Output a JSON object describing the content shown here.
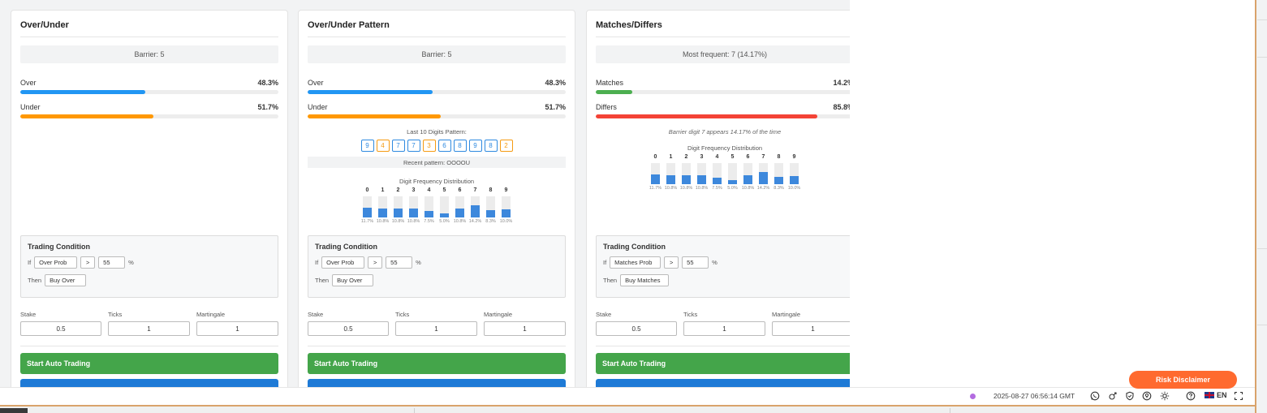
{
  "cards": [
    {
      "title": "Over/Under",
      "info": "Barrier: 5",
      "rows": [
        {
          "label": "Over",
          "value": "48.3%",
          "fraction": 0.483,
          "color": "#2196f3"
        },
        {
          "label": "Under",
          "value": "51.7%",
          "fraction": 0.517,
          "color": "#ff9800"
        }
      ],
      "condition": {
        "title": "Trading Condition",
        "if_label": "If",
        "metric": "Over Prob",
        "operator": ">",
        "threshold": "55",
        "unit": "%",
        "then_label": "Then",
        "action": "Buy Over"
      },
      "fields": [
        {
          "label": "Stake",
          "value": "0.5"
        },
        {
          "label": "Ticks",
          "value": "1"
        },
        {
          "label": "Martingale",
          "value": "1"
        }
      ],
      "start_label": "Start Auto Trading"
    },
    {
      "title": "Over/Under Pattern",
      "info": "Barrier: 5",
      "rows": [
        {
          "label": "Over",
          "value": "48.3%",
          "fraction": 0.483,
          "color": "#2196f3"
        },
        {
          "label": "Under",
          "value": "51.7%",
          "fraction": 0.517,
          "color": "#ff9800"
        }
      ],
      "pattern_title": "Last 10 Digits Pattern:",
      "pattern": [
        {
          "digit": "9",
          "type": "over"
        },
        {
          "digit": "4",
          "type": "under"
        },
        {
          "digit": "7",
          "type": "over"
        },
        {
          "digit": "7",
          "type": "over"
        },
        {
          "digit": "3",
          "type": "under"
        },
        {
          "digit": "6",
          "type": "over"
        },
        {
          "digit": "8",
          "type": "over"
        },
        {
          "digit": "9",
          "type": "over"
        },
        {
          "digit": "8",
          "type": "over"
        },
        {
          "digit": "2",
          "type": "under"
        }
      ],
      "recent_pattern": "Recent pattern: OOOOU",
      "dist_title": "Digit Frequency Distribution",
      "condition": {
        "title": "Trading Condition",
        "if_label": "If",
        "metric": "Over Prob",
        "operator": ">",
        "threshold": "55",
        "unit": "%",
        "then_label": "Then",
        "action": "Buy Over"
      },
      "fields": [
        {
          "label": "Stake",
          "value": "0.5"
        },
        {
          "label": "Ticks",
          "value": "1"
        },
        {
          "label": "Martingale",
          "value": "1"
        }
      ],
      "start_label": "Start Auto Trading"
    },
    {
      "title": "Matches/Differs",
      "info": "Most frequent: 7 (14.17%)",
      "rows": [
        {
          "label": "Matches",
          "value": "14.2%",
          "fraction": 0.142,
          "color": "#4caf50"
        },
        {
          "label": "Differs",
          "value": "85.8%",
          "fraction": 0.858,
          "color": "#f44336"
        }
      ],
      "note": "Barrier digit 7 appears 14.17% of the time",
      "dist_title": "Digit Frequency Distribution",
      "condition": {
        "title": "Trading Condition",
        "if_label": "If",
        "metric": "Matches Prob",
        "operator": ">",
        "threshold": "55",
        "unit": "%",
        "then_label": "Then",
        "action": "Buy Matches"
      },
      "fields": [
        {
          "label": "Stake",
          "value": "0.5"
        },
        {
          "label": "Ticks",
          "value": "1"
        },
        {
          "label": "Martingale",
          "value": "1"
        }
      ],
      "start_label": "Start Auto Trading"
    }
  ],
  "digit_distribution": [
    {
      "digit": "0",
      "pct": "11.7%",
      "fraction": 0.117
    },
    {
      "digit": "1",
      "pct": "10.8%",
      "fraction": 0.108
    },
    {
      "digit": "2",
      "pct": "10.8%",
      "fraction": 0.108
    },
    {
      "digit": "3",
      "pct": "10.8%",
      "fraction": 0.108
    },
    {
      "digit": "4",
      "pct": "7.5%",
      "fraction": 0.075
    },
    {
      "digit": "5",
      "pct": "5.0%",
      "fraction": 0.05
    },
    {
      "digit": "6",
      "pct": "10.8%",
      "fraction": 0.108
    },
    {
      "digit": "7",
      "pct": "14.2%",
      "fraction": 0.142
    },
    {
      "digit": "8",
      "pct": "8.3%",
      "fraction": 0.083
    },
    {
      "digit": "9",
      "pct": "10.0%",
      "fraction": 0.1
    }
  ],
  "footer": {
    "timestamp": "2025-08-27 06:56:14 GMT",
    "language": "EN",
    "risk_disclaimer": "Risk Disclaimer",
    "icons": [
      "whatsapp-icon",
      "signal-icon",
      "shield-icon",
      "responsible-trading-icon",
      "brightness-icon",
      "help-icon",
      "fullscreen-icon"
    ]
  }
}
